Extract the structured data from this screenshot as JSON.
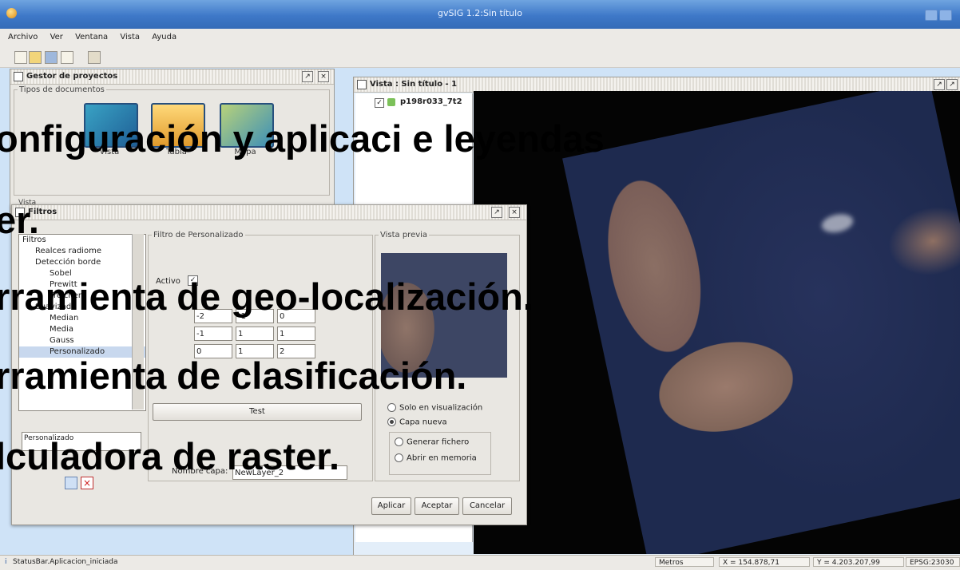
{
  "window": {
    "title": "gvSIG 1.2:Sin título"
  },
  "menu": [
    "Archivo",
    "Ver",
    "Ventana",
    "Vista",
    "Ayuda"
  ],
  "project_manager": {
    "title": "Gestor de proyectos",
    "doc_types_label": "Tipos de documentos",
    "doc_types": [
      "Vista",
      "Tabla",
      "Mapa"
    ],
    "views_label": "Vista"
  },
  "view_window": {
    "title": "Vista : Sin título - 1",
    "layer_name": "p198r033_7t2"
  },
  "filters_dialog": {
    "title": "Filtros",
    "tree": [
      "Filtros",
      "Realces radiome",
      "Detección borde",
      "Sobel",
      "Prewitt",
      "Freichen",
      "Suavizado",
      "Median",
      "Media",
      "Gauss",
      "Personalizado"
    ],
    "selected_name": "Personalizado",
    "custom_filter_label": "Filtro de Personalizado",
    "active_label": "Activo",
    "kernel": [
      [
        "-2",
        "-1",
        "0"
      ],
      [
        "-1",
        "1",
        "1"
      ],
      [
        "0",
        "1",
        "2"
      ]
    ],
    "test_label": "Test",
    "preview_label": "Vista previa",
    "radio_view_only": "Solo en visualización",
    "radio_new_layer": "Capa nueva",
    "generate_file": "Generar fichero",
    "open_in_memory": "Abrir en memoria",
    "layer_name_label": "Nombre capa:",
    "layer_name_value": "NewLayer_2",
    "apply": "Aplicar",
    "accept": "Aceptar",
    "cancel": "Cancelar"
  },
  "overlay_lines": [
    "onfiguración y aplicaci    e leyendas",
    "er.",
    "rramienta de geo-localización.",
    "rramienta de clasificación.",
    "lculadora de raster."
  ],
  "statusbar": {
    "message": "StatusBar.Aplicacion_iniciada",
    "units": "Metros",
    "x": "X = 154.878,71",
    "y": "Y = 4.203.207,99",
    "epsg": "EPSG:23030"
  }
}
